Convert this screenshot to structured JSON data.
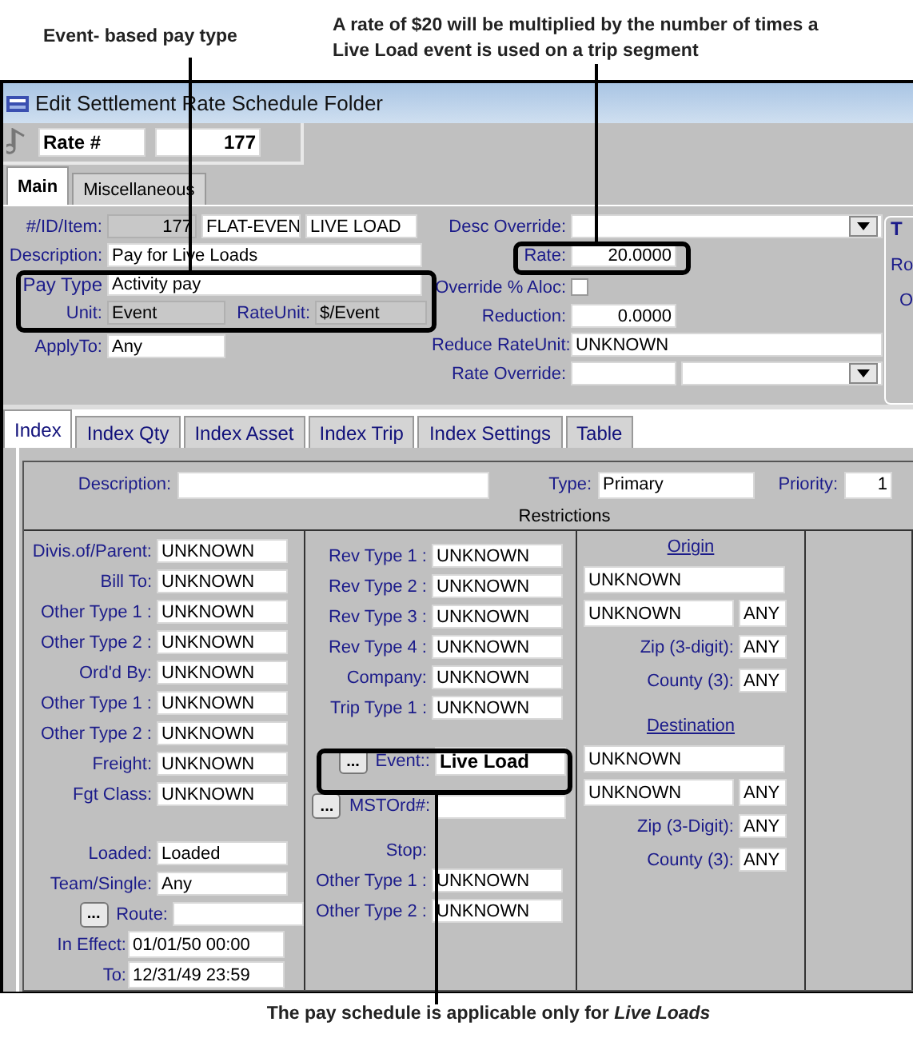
{
  "callouts": {
    "pay_type": "Event- based pay type",
    "rate": "A rate of $20 will be multiplied by the number of times a Live Load event is used on a trip segment",
    "event": "The pay schedule is applicable only for *Live Loads*"
  },
  "window": {
    "title": "Edit Settlement Rate Schedule Folder"
  },
  "record": {
    "label": "Rate #",
    "value": "177"
  },
  "main_tabs": [
    {
      "label": "Main",
      "selected": true
    },
    {
      "label": "Miscellaneous",
      "selected": false
    }
  ],
  "main_form": {
    "id_item": {
      "label": "#/ID/Item:",
      "id": "177",
      "code": "FLAT-EVEN",
      "item": "LIVE LOAD"
    },
    "description": {
      "label": "Description:",
      "value": "Pay for Live Loads"
    },
    "pay_type": {
      "label": "Pay Type",
      "value": "Activity pay"
    },
    "unit": {
      "label": "Unit:",
      "value": "Event"
    },
    "rate_unit": {
      "label": "RateUnit:",
      "value": "$/Event"
    },
    "apply_to": {
      "label": "ApplyTo:",
      "value": "Any"
    },
    "desc_override": {
      "label": "Desc Override:"
    },
    "rate": {
      "label": "Rate:",
      "value": "20.0000"
    },
    "override_aloc": {
      "label": "Override % Aloc:",
      "checked": false
    },
    "reduction": {
      "label": "Reduction:",
      "value": "0.0000"
    },
    "reduce_rate_unit": {
      "label": "Reduce RateUnit:",
      "value": "UNKNOWN"
    },
    "rate_override": {
      "label": "Rate Override:"
    }
  },
  "side_group": {
    "title": "T",
    "labels": [
      "Ro",
      "O"
    ]
  },
  "index_tabs": [
    {
      "label": "Index",
      "selected": true
    },
    {
      "label": "Index Qty",
      "selected": false
    },
    {
      "label": "Index Asset",
      "selected": false
    },
    {
      "label": "Index Trip",
      "selected": false
    },
    {
      "label": "Index Settings",
      "selected": false
    },
    {
      "label": "Table",
      "selected": false
    }
  ],
  "index_header": {
    "description": {
      "label": "Description:"
    },
    "type": {
      "label": "Type:",
      "value": "Primary"
    },
    "priority": {
      "label": "Priority:",
      "value": "1"
    }
  },
  "restrictions": {
    "title": "Restrictions",
    "column_1": [
      [
        {
          "kind": "field",
          "label": "Divis.of/Parent:",
          "value": "UNKNOWN"
        },
        {
          "kind": "field",
          "label": "Bill To:",
          "value": "UNKNOWN"
        },
        {
          "kind": "field",
          "label": "Other Type 1 :",
          "value": "UNKNOWN"
        },
        {
          "kind": "field",
          "label": "Other Type 2 :",
          "value": "UNKNOWN"
        },
        {
          "kind": "field",
          "label": "Ord'd By:",
          "value": "UNKNOWN"
        },
        {
          "kind": "field",
          "label": "Other Type 1 :",
          "value": "UNKNOWN"
        },
        {
          "kind": "field",
          "label": "Other Type 2 :",
          "value": "UNKNOWN"
        },
        {
          "kind": "field",
          "label": "Freight:",
          "value": "UNKNOWN"
        },
        {
          "kind": "field",
          "label": "Fgt Class:",
          "value": "UNKNOWN"
        }
      ],
      [
        {
          "kind": "field",
          "label": "Loaded:",
          "value": "Loaded"
        },
        {
          "kind": "field",
          "label": "Team/Single:",
          "value": "Any"
        },
        {
          "kind": "lookup",
          "label": "Route:",
          "button": "..."
        },
        {
          "kind": "date",
          "label": "In Effect:",
          "value": "01/01/50 00:00"
        },
        {
          "kind": "date",
          "label": "To:",
          "value": "12/31/49 23:59"
        }
      ]
    ],
    "column_2": [
      [
        {
          "kind": "field",
          "label": "Rev Type 1 :",
          "value": "UNKNOWN"
        },
        {
          "kind": "field",
          "label": "Rev Type 2 :",
          "value": "UNKNOWN"
        },
        {
          "kind": "field",
          "label": "Rev Type 3 :",
          "value": "UNKNOWN"
        },
        {
          "kind": "field",
          "label": "Rev Type 4 :",
          "value": "UNKNOWN"
        },
        {
          "kind": "field",
          "label": "Company:",
          "value": "UNKNOWN"
        },
        {
          "kind": "field",
          "label": "Trip Type 1 :",
          "value": "UNKNOWN"
        }
      ],
      [
        {
          "kind": "lookup",
          "label": "Event::",
          "button": "...",
          "value": "Live Load",
          "bold": true
        },
        {
          "kind": "lookup",
          "label": "MSTOrd#:",
          "button": "...",
          "bold": false
        }
      ],
      [
        {
          "kind": "heading",
          "label": "Stop:"
        },
        {
          "kind": "field",
          "label": "Other Type 1 :",
          "value": "UNKNOWN"
        },
        {
          "kind": "field",
          "label": "Other Type 2 :",
          "value": "UNKNOWN"
        }
      ]
    ],
    "origin": {
      "title": "Origin",
      "location": "UNKNOWN",
      "city": "UNKNOWN",
      "city_scope": "ANY",
      "zip": {
        "label": "Zip (3-digit):",
        "value": "ANY"
      },
      "county": {
        "label": "County (3):",
        "value": "ANY"
      }
    },
    "destination": {
      "title": "Destination",
      "location": "UNKNOWN",
      "city": "UNKNOWN",
      "city_scope": "ANY",
      "zip": {
        "label": "Zip (3-Digit):",
        "value": "ANY"
      },
      "county": {
        "label": "County (3):",
        "value": "ANY"
      }
    }
  }
}
